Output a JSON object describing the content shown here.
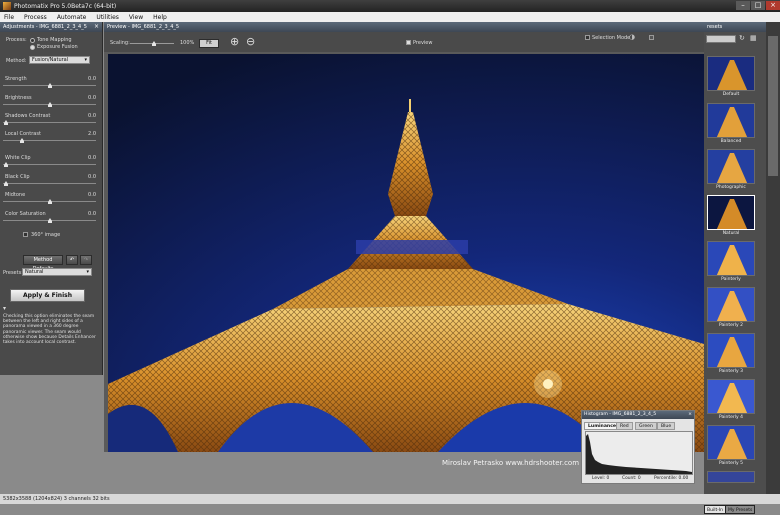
{
  "window": {
    "title": "Photomatix Pro 5.0Beta7c (64-bit)"
  },
  "menu": [
    "File",
    "Process",
    "Automate",
    "Utilities",
    "View",
    "Help"
  ],
  "adjustments": {
    "panel_title": "Adjustments - IMG_6881_2_3_4_5",
    "process_label": "Process:",
    "process_options": [
      "Tone Mapping",
      "Exposure Fusion"
    ],
    "method_label": "Method:",
    "method_value": "Fusion/Natural",
    "sliders": [
      {
        "label": "Strength",
        "value": "0.0",
        "level": 0.5
      },
      {
        "label": "Brightness",
        "value": "0.0",
        "level": 0.5
      },
      {
        "label": "Shadows Contrast",
        "value": "0.0",
        "level": 0.02
      },
      {
        "label": "Local Contrast",
        "value": "2.0",
        "level": 0.18
      },
      {
        "label": "White Clip",
        "value": "0.0",
        "level": 0.02
      },
      {
        "label": "Black Clip",
        "value": "0.0",
        "level": 0.02
      },
      {
        "label": "Midtone",
        "value": "0.0",
        "level": 0.5
      },
      {
        "label": "Color Saturation",
        "value": "0.0",
        "level": 0.5
      }
    ],
    "image_360_label": "360° image",
    "method_defaults_label": "Method Defaults",
    "presets_label": "Presets:",
    "presets_value": "Natural",
    "apply_label": "Apply & Finish",
    "info_text": "Checking this option eliminates the seam between the left and right sides of a panorama viewed in a 360 degree panoramic viewer. The seam would otherwise show because Details Enhancer takes into account local contrast."
  },
  "preview": {
    "title": "Preview - IMG_6881_2_3_4_5",
    "scaling_label": "Scaling:",
    "scaling_value": "100%",
    "fit_label": "Fit",
    "preview_checkbox_label": "Preview",
    "selection_mode_label": "Selection Mode",
    "credit": "Miroslav Petrasko  www.hdrshooter.com"
  },
  "presets": {
    "title": "resets",
    "items": [
      "Default",
      "Balanced",
      "Photographic",
      "Natural",
      "Painterly",
      "Painterly 2",
      "Painterly 3",
      "Painterly 4",
      "Painterly 5"
    ],
    "selected": "Natural",
    "tabs": [
      "Built-In",
      "My Presets"
    ]
  },
  "histogram": {
    "title": "Histogram - IMG_6881_2_3_4_5",
    "tabs": [
      "Luminance",
      "Red",
      "Green",
      "Blue"
    ],
    "level_label": "Level: 0",
    "count_label": "Count: 0",
    "percentile_label": "Percentile: 0.00"
  },
  "status": {
    "text": "5382x3588 (1204x824) 3 channels 32 bits"
  },
  "colors": {
    "panel": "#4a4a4a",
    "header": "#3d4754",
    "sky": "#0b1a3a",
    "tower": "#e0a030"
  }
}
